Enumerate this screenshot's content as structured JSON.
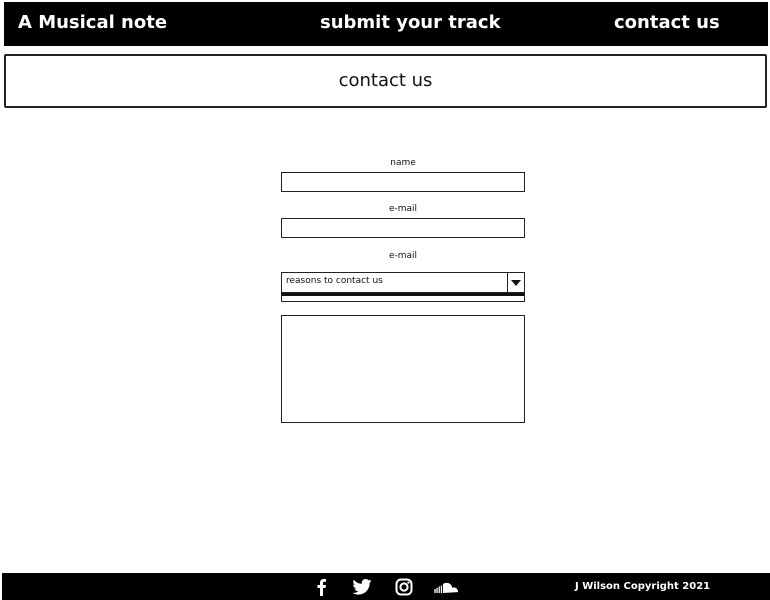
{
  "nav": {
    "brand": "A Musical note",
    "links": [
      {
        "label": "submit your track"
      },
      {
        "label": "contact us"
      }
    ]
  },
  "page": {
    "title": "contact us"
  },
  "form": {
    "name_label": "name",
    "email_label": "e-mail",
    "select_label": "e-mail",
    "select_value": "reasons to contact us"
  },
  "footer": {
    "social_icons": [
      "facebook-icon",
      "twitter-icon",
      "instagram-icon",
      "soundcloud-icon"
    ],
    "copyright": "J Wilson Copyright 2021"
  }
}
